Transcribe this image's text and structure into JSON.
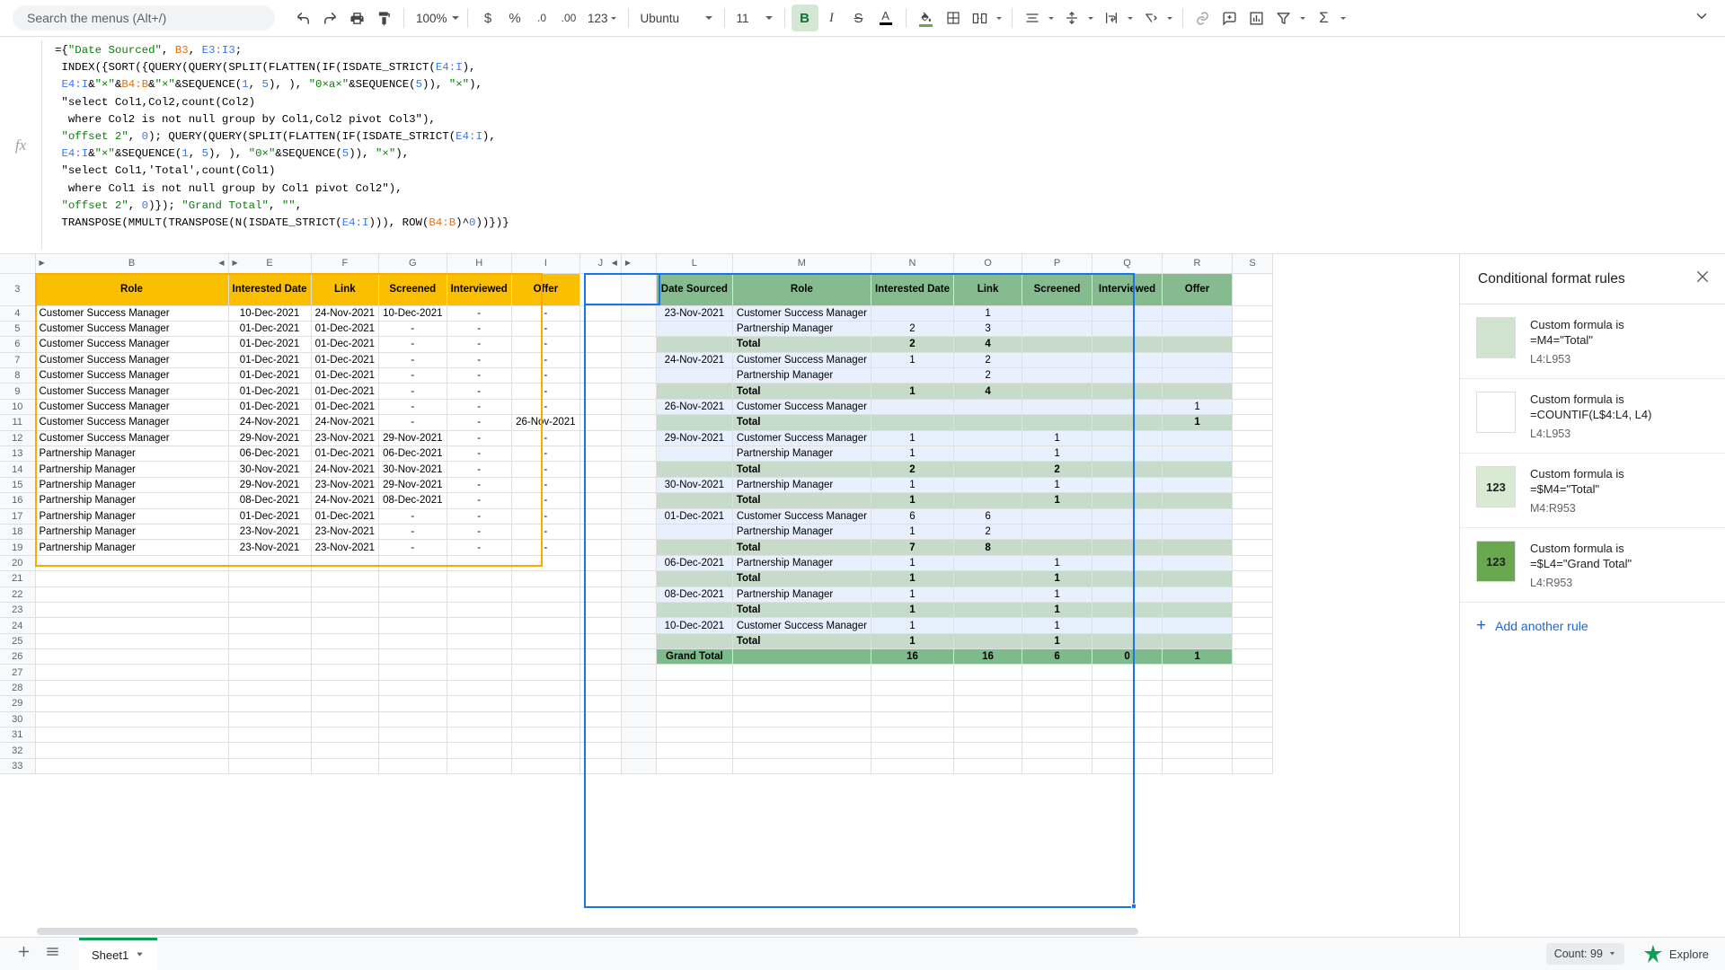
{
  "toolbar": {
    "search_placeholder": "Search the menus (Alt+/)",
    "undo": "undo-icon",
    "redo": "redo-icon",
    "print": "print-icon",
    "paint_format": "paint-format-icon",
    "zoom": "100%",
    "currency": "$",
    "percent": "%",
    "decrease_decimal": ".0",
    "increase_decimal": ".00",
    "more_formats": "123",
    "font": "Ubuntu",
    "font_size": "11",
    "bold": "B",
    "italic": "I",
    "strikethrough": "S",
    "text_color": "A",
    "fill_color": "fill-color-icon",
    "borders": "borders-icon",
    "merge_cells": "merge-cells-icon",
    "horizontal_align": "horizontal-align-icon",
    "vertical_align": "vertical-align-icon",
    "text_wrap": "text-wrap-icon",
    "text_rotation": "text-rotation-icon",
    "insert_link": "link-icon",
    "insert_comment": "comment-icon",
    "insert_chart": "chart-icon",
    "create_filter": "filter-icon",
    "functions": "sigma-icon",
    "collapse": "chevron-down-icon"
  },
  "formula_bar": {
    "fx_label": "fx",
    "lines": [
      "={\"Date Sourced\", B3, E3:I3;",
      " INDEX({SORT({QUERY(QUERY(SPLIT(FLATTEN(IF(ISDATE_STRICT(E4:I),",
      " E4:I&\"×\"&B4:B&\"×\"&SEQUENCE(1, 5), ), \"0×a×\"&SEQUENCE(5)), \"×\"),",
      " \"select Col1,Col2,count(Col2)",
      "  where Col2 is not null group by Col1,Col2 pivot Col3\"),",
      " \"offset 2\", 0); QUERY(QUERY(SPLIT(FLATTEN(IF(ISDATE_STRICT(E4:I),",
      " E4:I&\"×\"&SEQUENCE(1, 5), ), \"0×\"&SEQUENCE(5)), \"×\"),",
      " \"select Col1,'Total',count(Col1)",
      "  where Col1 is not null group by Col1 pivot Col2\"),",
      " \"offset 2\", 0)}); \"Grand Total\", \"\",",
      " TRANSPOSE(MMULT(TRANSPOSE(N(ISDATE_STRICT(E4:I))), ROW(B4:B)^0))})}"
    ]
  },
  "left_table": {
    "column_letters": [
      "B",
      "E",
      "F",
      "G",
      "H",
      "I",
      "J"
    ],
    "headers": [
      "Role",
      "Interested Date",
      "Link",
      "Screened",
      "Interviewed",
      "Offer"
    ],
    "rows": [
      {
        "n": "4",
        "cells": [
          "Customer Success Manager",
          "10-Dec-2021",
          "24-Nov-2021",
          "10-Dec-2021",
          "-",
          "-"
        ]
      },
      {
        "n": "5",
        "cells": [
          "Customer Success Manager",
          "01-Dec-2021",
          "01-Dec-2021",
          "-",
          "-",
          "-"
        ]
      },
      {
        "n": "6",
        "cells": [
          "Customer Success Manager",
          "01-Dec-2021",
          "01-Dec-2021",
          "-",
          "-",
          "-"
        ]
      },
      {
        "n": "7",
        "cells": [
          "Customer Success Manager",
          "01-Dec-2021",
          "01-Dec-2021",
          "-",
          "-",
          "-"
        ]
      },
      {
        "n": "8",
        "cells": [
          "Customer Success Manager",
          "01-Dec-2021",
          "01-Dec-2021",
          "-",
          "-",
          "-"
        ]
      },
      {
        "n": "9",
        "cells": [
          "Customer Success Manager",
          "01-Dec-2021",
          "01-Dec-2021",
          "-",
          "-",
          "-"
        ]
      },
      {
        "n": "10",
        "cells": [
          "Customer Success Manager",
          "01-Dec-2021",
          "01-Dec-2021",
          "-",
          "-",
          "-"
        ]
      },
      {
        "n": "11",
        "cells": [
          "Customer Success Manager",
          "24-Nov-2021",
          "24-Nov-2021",
          "-",
          "-",
          "26-Nov-2021"
        ]
      },
      {
        "n": "12",
        "cells": [
          "Customer Success Manager",
          "29-Nov-2021",
          "23-Nov-2021",
          "29-Nov-2021",
          "-",
          "-"
        ]
      },
      {
        "n": "13",
        "cells": [
          "Partnership Manager",
          "06-Dec-2021",
          "01-Dec-2021",
          "06-Dec-2021",
          "-",
          "-"
        ]
      },
      {
        "n": "14",
        "cells": [
          "Partnership Manager",
          "30-Nov-2021",
          "24-Nov-2021",
          "30-Nov-2021",
          "-",
          "-"
        ]
      },
      {
        "n": "15",
        "cells": [
          "Partnership Manager",
          "29-Nov-2021",
          "23-Nov-2021",
          "29-Nov-2021",
          "-",
          "-"
        ]
      },
      {
        "n": "16",
        "cells": [
          "Partnership Manager",
          "08-Dec-2021",
          "24-Nov-2021",
          "08-Dec-2021",
          "-",
          "-"
        ]
      },
      {
        "n": "17",
        "cells": [
          "Partnership Manager",
          "01-Dec-2021",
          "01-Dec-2021",
          "-",
          "-",
          "-"
        ]
      },
      {
        "n": "18",
        "cells": [
          "Partnership Manager",
          "23-Nov-2021",
          "23-Nov-2021",
          "-",
          "-",
          "-"
        ]
      },
      {
        "n": "19",
        "cells": [
          "Partnership Manager",
          "23-Nov-2021",
          "23-Nov-2021",
          "-",
          "-",
          "-"
        ]
      }
    ],
    "empty_row_numbers": [
      "20",
      "21",
      "22",
      "23",
      "24",
      "25",
      "26",
      "27",
      "28",
      "29",
      "30",
      "31",
      "32",
      "33"
    ]
  },
  "pivot_table": {
    "column_letters": [
      "L",
      "M",
      "N",
      "O",
      "P",
      "Q",
      "R",
      "S"
    ],
    "headers": [
      "Date Sourced",
      "Role",
      "Interested Date",
      "Link",
      "Screened",
      "Interviewed",
      "Offer"
    ],
    "rows": [
      {
        "n": "4",
        "type": "data",
        "date": "23-Nov-2021",
        "role": "Customer Success Manager",
        "values": [
          "",
          "1",
          "",
          "",
          ""
        ]
      },
      {
        "n": "5",
        "type": "data",
        "date": "",
        "role": "Partnership Manager",
        "values": [
          "2",
          "3",
          "",
          "",
          ""
        ]
      },
      {
        "n": "6",
        "type": "total",
        "date": "",
        "role": "Total",
        "values": [
          "2",
          "4",
          "",
          "",
          ""
        ]
      },
      {
        "n": "7",
        "type": "data",
        "date": "24-Nov-2021",
        "role": "Customer Success Manager",
        "values": [
          "1",
          "2",
          "",
          "",
          ""
        ]
      },
      {
        "n": "8",
        "type": "data",
        "date": "",
        "role": "Partnership Manager",
        "values": [
          "",
          "2",
          "",
          "",
          ""
        ]
      },
      {
        "n": "9",
        "type": "total",
        "date": "",
        "role": "Total",
        "values": [
          "1",
          "4",
          "",
          "",
          ""
        ]
      },
      {
        "n": "10",
        "type": "data",
        "date": "26-Nov-2021",
        "role": "Customer Success Manager",
        "values": [
          "",
          "",
          "",
          "",
          "1"
        ]
      },
      {
        "n": "11",
        "type": "total",
        "date": "",
        "role": "Total",
        "values": [
          "",
          "",
          "",
          "",
          "1"
        ]
      },
      {
        "n": "12",
        "type": "data",
        "date": "29-Nov-2021",
        "role": "Customer Success Manager",
        "values": [
          "1",
          "",
          "1",
          "",
          ""
        ]
      },
      {
        "n": "13",
        "type": "data",
        "date": "",
        "role": "Partnership Manager",
        "values": [
          "1",
          "",
          "1",
          "",
          ""
        ]
      },
      {
        "n": "14",
        "type": "total",
        "date": "",
        "role": "Total",
        "values": [
          "2",
          "",
          "2",
          "",
          ""
        ]
      },
      {
        "n": "15",
        "type": "data",
        "date": "30-Nov-2021",
        "role": "Partnership Manager",
        "values": [
          "1",
          "",
          "1",
          "",
          ""
        ]
      },
      {
        "n": "16",
        "type": "total",
        "date": "",
        "role": "Total",
        "values": [
          "1",
          "",
          "1",
          "",
          ""
        ]
      },
      {
        "n": "17",
        "type": "data",
        "date": "01-Dec-2021",
        "role": "Customer Success Manager",
        "values": [
          "6",
          "6",
          "",
          "",
          ""
        ]
      },
      {
        "n": "18",
        "type": "data",
        "date": "",
        "role": "Partnership Manager",
        "values": [
          "1",
          "2",
          "",
          "",
          ""
        ]
      },
      {
        "n": "19",
        "type": "total",
        "date": "",
        "role": "Total",
        "values": [
          "7",
          "8",
          "",
          "",
          ""
        ]
      },
      {
        "n": "20",
        "type": "data",
        "date": "06-Dec-2021",
        "role": "Partnership Manager",
        "values": [
          "1",
          "",
          "1",
          "",
          ""
        ]
      },
      {
        "n": "21",
        "type": "total",
        "date": "",
        "role": "Total",
        "values": [
          "1",
          "",
          "1",
          "",
          ""
        ]
      },
      {
        "n": "22",
        "type": "data",
        "date": "08-Dec-2021",
        "role": "Partnership Manager",
        "values": [
          "1",
          "",
          "1",
          "",
          ""
        ]
      },
      {
        "n": "23",
        "type": "total",
        "date": "",
        "role": "Total",
        "values": [
          "1",
          "",
          "1",
          "",
          ""
        ]
      },
      {
        "n": "24",
        "type": "data",
        "date": "10-Dec-2021",
        "role": "Customer Success Manager",
        "values": [
          "1",
          "",
          "1",
          "",
          ""
        ]
      },
      {
        "n": "25",
        "type": "total",
        "date": "",
        "role": "Total",
        "values": [
          "1",
          "",
          "1",
          "",
          ""
        ]
      },
      {
        "n": "26",
        "type": "grand",
        "date": "Grand Total",
        "role": "",
        "values": [
          "16",
          "16",
          "6",
          "0",
          "1"
        ]
      }
    ]
  },
  "sidebar": {
    "title": "Conditional format rules",
    "close_icon": "close-icon",
    "rules": [
      {
        "swatch_text": "",
        "swatch_color": "#cfe3cf",
        "line1": "Custom formula is",
        "line2": "=M4=\"Total\"",
        "range": "L4:L953"
      },
      {
        "swatch_text": "",
        "swatch_color": "#ffffff",
        "line1": "Custom formula is",
        "line2": "=COUNTIF(L$4:L4, L4)",
        "range": "L4:L953"
      },
      {
        "swatch_text": "123",
        "swatch_color": "#d9ead3",
        "line1": "Custom formula is",
        "line2": "=$M4=\"Total\"",
        "range": "M4:R953"
      },
      {
        "swatch_text": "123",
        "swatch_color": "#6aa84f",
        "line1": "Custom formula is",
        "line2": "=$L4=\"Grand Total\"",
        "range": "L4:R953"
      }
    ],
    "add_rule_label": "Add another rule",
    "add_rule_icon": "plus-icon"
  },
  "bottom_bar": {
    "add_sheet_icon": "plus-icon",
    "all_sheets_icon": "list-icon",
    "sheet_name": "Sheet1",
    "sheet_menu_icon": "chevron-down-icon",
    "count_label": "Count: 99",
    "explore_label": "Explore"
  }
}
